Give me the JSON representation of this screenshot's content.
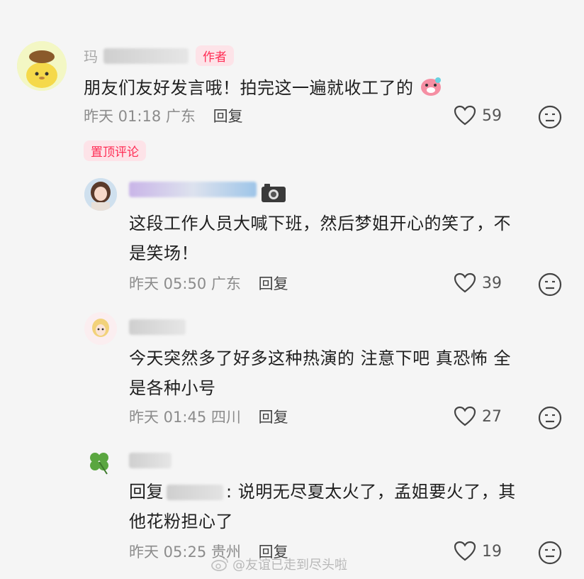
{
  "comments": [
    {
      "name_first": "玛",
      "badge": "作者",
      "text": "朋友们友好发言哦！拍完这一遍就收工了的",
      "time": "昨天 01:18",
      "location": "广东",
      "reply_label": "回复",
      "likes": "59"
    },
    {
      "pinned_label": "置顶评论",
      "text_line1": "这段工作人员大喊下班，然后梦姐开心的笑了，不",
      "text_line2": "是笑场！",
      "time": "昨天 05:50",
      "location": "广东",
      "reply_label": "回复",
      "likes": "39"
    },
    {
      "text_line1": "今天突然多了好多这种热演的 注意下吧 真恐怖 全",
      "text_line2": "是各种小号",
      "time": "昨天 01:45",
      "location": "四川",
      "reply_label": "回复",
      "likes": "27"
    },
    {
      "reply_prefix": "回复",
      "text_line1_rest": ": 说明无尽夏太火了，孟姐要火了，其",
      "text_line2": "他花粉担心了",
      "time": "昨天 05:25",
      "location": "贵州",
      "reply_label": "回复",
      "likes": "19"
    }
  ],
  "watermark": "@友谊已走到尽头啦",
  "colors": {
    "accent": "#ff2d55",
    "badge_bg": "#fde3e8",
    "meta": "#8c8c8c"
  },
  "icons": {
    "like": "heart-icon",
    "emoji": "emoji-face-icon",
    "camera": "camera-icon",
    "weibo": "weibo-icon"
  }
}
